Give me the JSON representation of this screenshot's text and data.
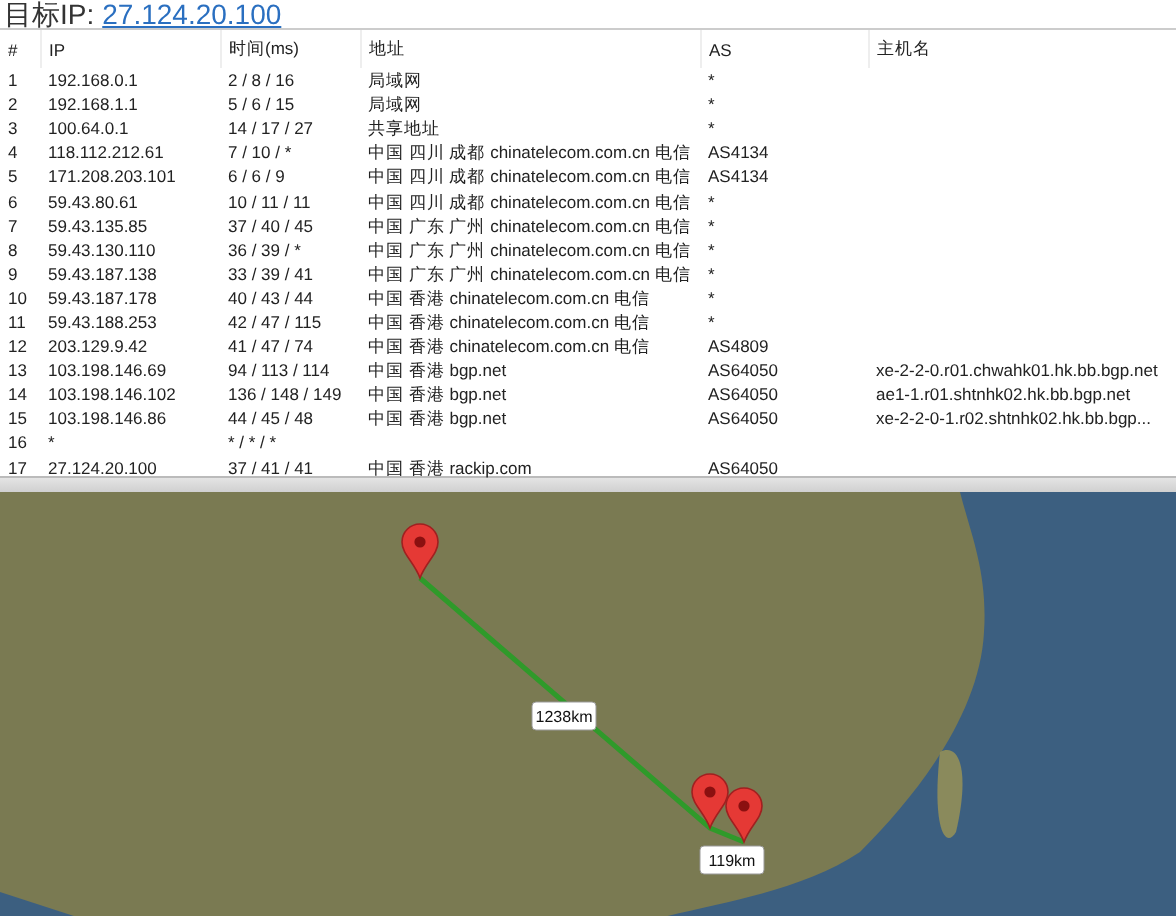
{
  "target": {
    "label": "目标IP:",
    "ip": "27.124.20.100"
  },
  "table": {
    "columns": [
      "#",
      "IP",
      "时间(ms)",
      "地址",
      "AS",
      "主机名"
    ],
    "rows": [
      [
        "1",
        "192.168.0.1",
        "2 / 8 / 16",
        "局域网",
        "*",
        ""
      ],
      [
        "2",
        "192.168.1.1",
        "5 / 6 / 15",
        "局域网",
        "*",
        ""
      ],
      [
        "3",
        "100.64.0.1",
        "14 / 17 / 27",
        "共享地址",
        "*",
        ""
      ],
      [
        "4",
        "118.112.212.61",
        "7 / 10 / *",
        "中国 四川 成都 chinatelecom.com.cn 电信",
        "AS4134",
        ""
      ],
      [
        "5",
        "171.208.203.101",
        "6 / 6 / 9",
        "中国 四川 成都 chinatelecom.com.cn 电信",
        "AS4134",
        ""
      ],
      [
        "6",
        "59.43.80.61",
        "10 / 11 / 11",
        "中国 四川 成都 chinatelecom.com.cn 电信",
        "*",
        ""
      ],
      [
        "7",
        "59.43.135.85",
        "37 / 40 / 45",
        "中国 广东 广州 chinatelecom.com.cn 电信",
        "*",
        ""
      ],
      [
        "8",
        "59.43.130.110",
        "36 / 39 / *",
        "中国 广东 广州 chinatelecom.com.cn 电信",
        "*",
        ""
      ],
      [
        "9",
        "59.43.187.138",
        "33 / 39 / 41",
        "中国 广东 广州 chinatelecom.com.cn 电信",
        "*",
        ""
      ],
      [
        "10",
        "59.43.187.178",
        "40 / 43 / 44",
        "中国 香港 chinatelecom.com.cn 电信",
        "*",
        ""
      ],
      [
        "11",
        "59.43.188.253",
        "42 / 47 / 115",
        "中国 香港 chinatelecom.com.cn 电信",
        "*",
        ""
      ],
      [
        "12",
        "203.129.9.42",
        "41 / 47 / 74",
        "中国 香港 chinatelecom.com.cn 电信",
        "AS4809",
        ""
      ],
      [
        "13",
        "103.198.146.69",
        "94 / 113 / 114",
        "中国 香港 bgp.net",
        "AS64050",
        "xe-2-2-0.r01.chwahk01.hk.bb.bgp.net"
      ],
      [
        "14",
        "103.198.146.102",
        "136 / 148 / 149",
        "中国 香港 bgp.net",
        "AS64050",
        "ae1-1.r01.shtnhk02.hk.bb.bgp.net"
      ],
      [
        "15",
        "103.198.146.86",
        "44 / 45 / 48",
        "中国 香港 bgp.net",
        "AS64050",
        "xe-2-2-0-1.r02.shtnhk02.hk.bb.bgp..."
      ],
      [
        "16",
        "*",
        "* / * / *",
        "",
        "",
        ""
      ],
      [
        "17",
        "27.124.20.100",
        "37 / 41 / 41",
        "中国 香港 rackip.com",
        "AS64050",
        ""
      ]
    ]
  },
  "map": {
    "segments": [
      {
        "distance": "1238km"
      },
      {
        "distance": "119km"
      }
    ]
  }
}
